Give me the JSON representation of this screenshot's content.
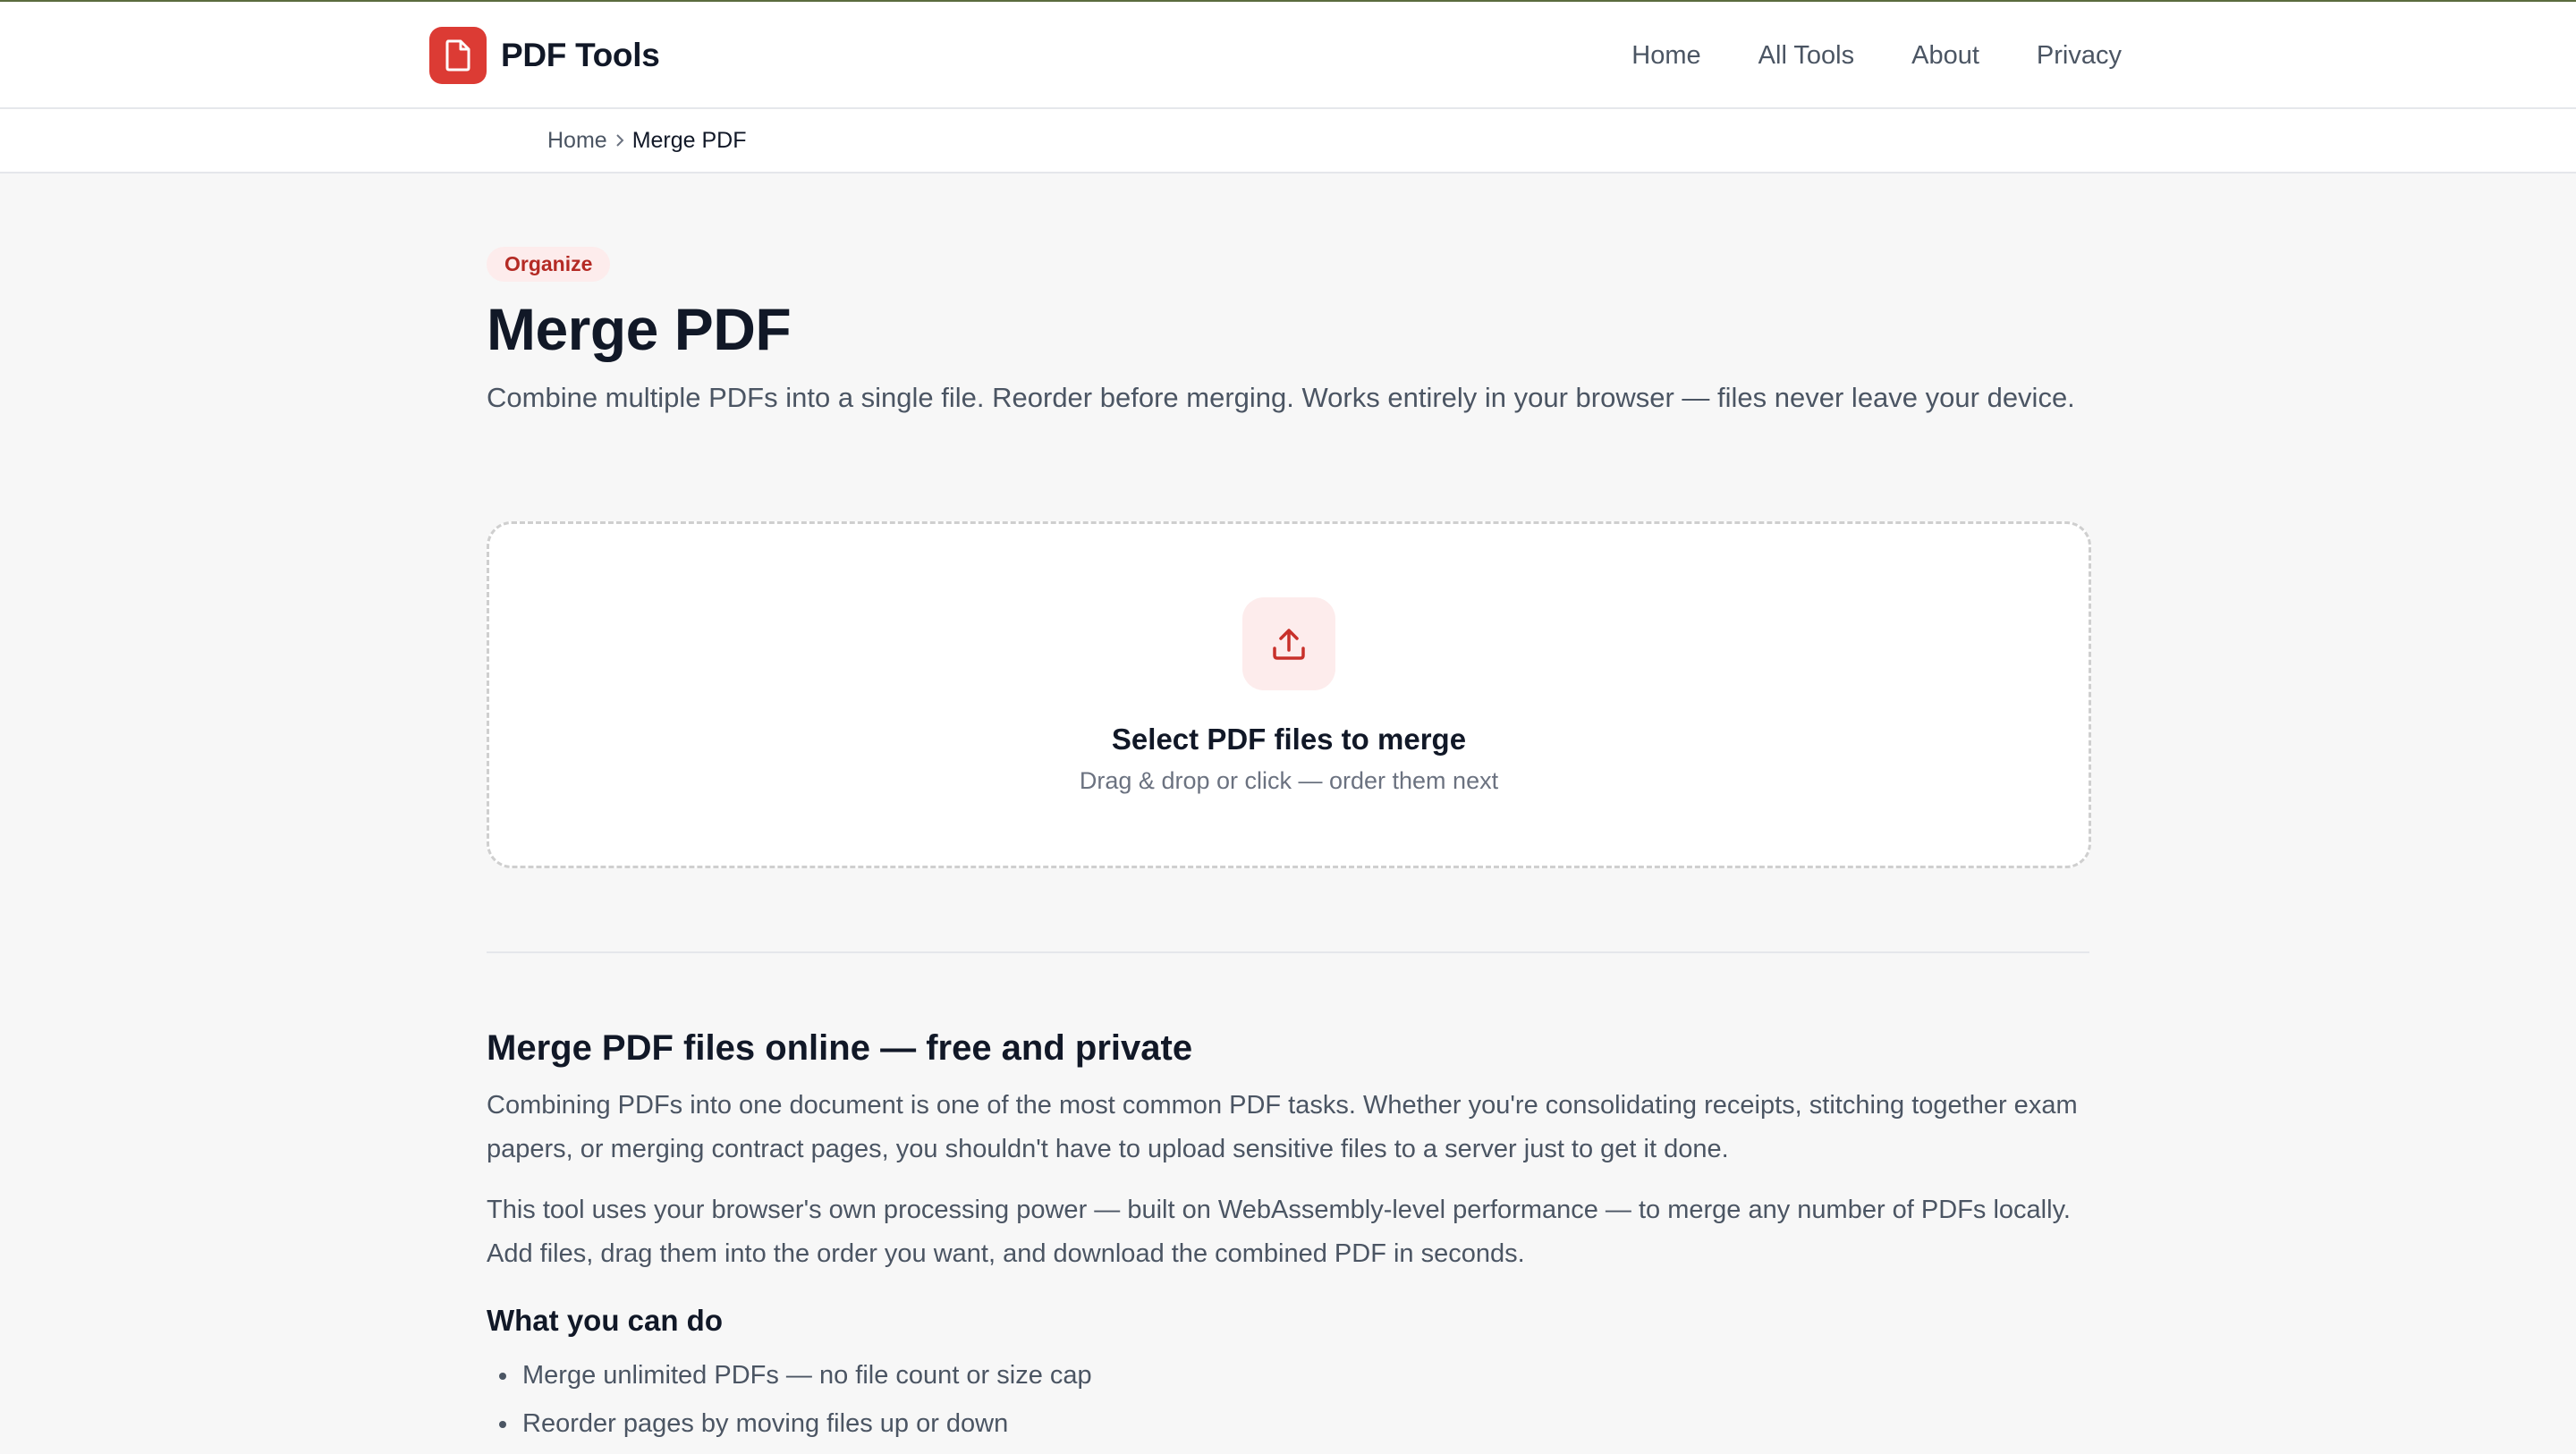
{
  "colors": {
    "accent": "#dc3b34",
    "accent_soft": "#fdecec",
    "text_primary": "#111827",
    "text_secondary": "#4b5563",
    "background": "#f7f7f7"
  },
  "header": {
    "brand": {
      "name": "PDF Tools",
      "icon": "pdf-file-icon"
    },
    "nav": [
      {
        "label": "Home"
      },
      {
        "label": "All Tools"
      },
      {
        "label": "About"
      },
      {
        "label": "Privacy"
      }
    ]
  },
  "breadcrumb": {
    "home": "Home",
    "separator_icon": "chevron-right-icon",
    "current": "Merge PDF"
  },
  "tool": {
    "category": "Organize",
    "title": "Merge PDF",
    "description": "Combine multiple PDFs into a single file. Reorder before merging. Works entirely in your browser — files never leave your device."
  },
  "dropzone": {
    "icon": "upload-icon",
    "title": "Select PDF files to merge",
    "subtitle": "Drag & drop or click — order them next"
  },
  "content": {
    "heading": "Merge PDF files online — free and private",
    "paragraphs": [
      "Combining PDFs into one document is one of the most common PDF tasks. Whether you're consolidating receipts, stitching together exam papers, or merging contract pages, you shouldn't have to upload sensitive files to a server just to get it done.",
      "This tool uses your browser's own processing power — built on WebAssembly-level performance — to merge any number of PDFs locally. Add files, drag them into the order you want, and download the combined PDF in seconds."
    ],
    "features_heading": "What you can do",
    "features": [
      "Merge unlimited PDFs — no file count or size cap",
      "Reorder pages by moving files up or down"
    ]
  }
}
